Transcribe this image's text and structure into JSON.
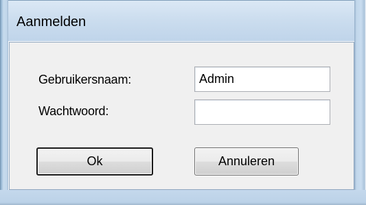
{
  "window": {
    "title": "Aanmelden"
  },
  "form": {
    "username_label": "Gebruikersnaam:",
    "username_value": "Admin",
    "password_label": "Wachtwoord:",
    "password_value": ""
  },
  "buttons": {
    "ok_label": "Ok",
    "cancel_label": "Annuleren"
  }
}
